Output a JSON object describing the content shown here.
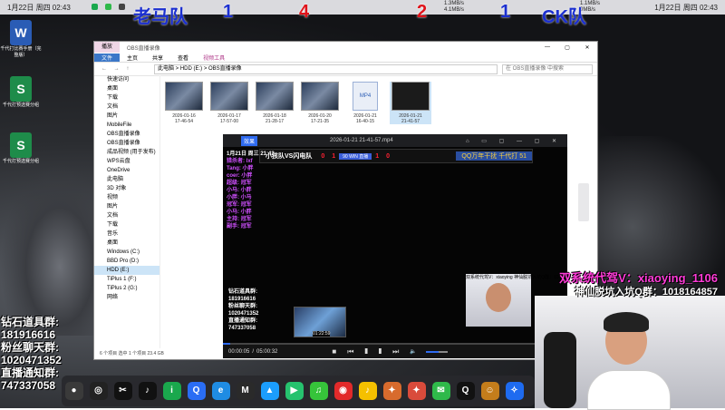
{
  "status_bar": {
    "left_time": "1月22日 周四 02:43",
    "right_time": "1月22日 周四 02:43",
    "net_speed_1": "1.3MB/s",
    "net_speed_2": "4.1MB/s",
    "net_speed_3": "1.1MB/s",
    "net_speed_4": "0MB/s"
  },
  "score_overlay": {
    "team_left": "老马队",
    "team_right": "CK队",
    "scores": [
      "1",
      "4",
      "2",
      "1"
    ]
  },
  "desktop_icons": [
    {
      "label": "千代打比赛手册（完整版）",
      "color": "#2a5cb5",
      "glyph": "W"
    },
    {
      "label": "千代打预选赛分组",
      "color": "#1e8c4a",
      "glyph": "S"
    },
    {
      "label": "千代打预选赛分组",
      "color": "#1e8c4a",
      "glyph": "S"
    }
  ],
  "explorer": {
    "tab_label": "播放",
    "window_title": "OBS直播录像",
    "ribbon": [
      "文件",
      "主页",
      "共享",
      "查看",
      "视频工具"
    ],
    "path": "此电脑 > HDD (E:) > OBS直播录像",
    "search_placeholder": "在 OBS直播录像 中搜索",
    "sidebar": [
      "快速访问",
      "桌面",
      "下载",
      "文档",
      "图片",
      "MobileFile",
      "OBS直播录像",
      "OBS直播录像",
      "成品视频 (用于发布)",
      "WPS云盘",
      "OneDrive",
      "此电脑",
      "3D 对象",
      "视频",
      "图片",
      "文档",
      "下载",
      "音乐",
      "桌面",
      "Windows (C:)",
      "BBD Pro (D:)",
      "HDD (E:)",
      "TiPlus 1 (F:)",
      "TiPlus 2 (G:)",
      "网络"
    ],
    "files": [
      {
        "date": "2026-01-16",
        "time": "17-46-54"
      },
      {
        "date": "2026-01-17",
        "time": "17-57-00"
      },
      {
        "date": "2026-01-18",
        "time": "21-28-17"
      },
      {
        "date": "2026-01-20",
        "time": "17-21-35"
      },
      {
        "date": "2026-01-21",
        "time": "16-40-15"
      },
      {
        "date": "2026-01-21",
        "time": "21-41-57"
      }
    ],
    "mp4_label": "MP4",
    "footer": "6 个项目    选中 1 个项目  23.4 GB"
  },
  "player": {
    "logo": "效果",
    "title": "2026-01-21 21-41-57.mp4",
    "window_buttons": "⌂ ▭ ▢ — ▢ ✕",
    "time_current": "00:00:05",
    "time_total": "05:00:32",
    "speed_label": "倍速",
    "progress": 0.02,
    "volume": 0.6,
    "scorebar": {
      "left_team": "小孩队VS闪电队",
      "left_score": "0",
      "left_score2": "1",
      "mid": "90 WIN  直播",
      "right_score": "1",
      "right_score2": "0",
      "right_label": "QQ万年干扰 千代打 51"
    },
    "left_text": [
      "1月21日 周三 21:42",
      "猎杀者: lxf",
      "Tang: 小胖",
      "coer: 小胖",
      "",
      "超级: 冠军",
      "小马: 小胖",
      "小胖: 小马",
      "",
      "冠军: 冠军",
      "小马: 小胖",
      "主持: 冠军",
      "副手: 冠军"
    ],
    "bottom_text": [
      "钻石道具群:",
      "181916616",
      "粉丝聊天群:",
      "1020471352",
      "直播通知群:",
      "747337058"
    ],
    "thumb_time": "01:22:59"
  },
  "right_overlay": {
    "ad_line_1": "双系统代驾V：xiaoying_1106",
    "ad_line_2": "神仙脱坑入坑Q群：1018164857",
    "small_text": "双系统代驾V：xiaoying 神仙脱坑入坑Q群：1018"
  },
  "left_overlay": [
    "钻石道具群:",
    "181916616",
    "粉丝聊天群:",
    "1020471352",
    "直播通知群:",
    "747337058"
  ],
  "taskbar_apps": [
    {
      "name": "obs-studio",
      "color": "#3a3a3a",
      "glyph": "●"
    },
    {
      "name": "obs-icon-2",
      "color": "#222",
      "glyph": "◎"
    },
    {
      "name": "capcut",
      "color": "#111",
      "glyph": "✂"
    },
    {
      "name": "tiktok",
      "color": "#111",
      "glyph": "♪"
    },
    {
      "name": "iqiyi",
      "color": "#1aa84d",
      "glyph": "i"
    },
    {
      "name": "search-app",
      "color": "#2a6df4",
      "glyph": "Q"
    },
    {
      "name": "edge",
      "color": "#1f8ce3",
      "glyph": "e"
    },
    {
      "name": "mango",
      "color": "#2a2a2a",
      "glyph": "M"
    },
    {
      "name": "tencent-video",
      "color": "#1b9dfc",
      "glyph": "▲"
    },
    {
      "name": "video-player",
      "color": "#26c26e",
      "glyph": "▶"
    },
    {
      "name": "music",
      "color": "#36c43a",
      "glyph": "♫"
    },
    {
      "name": "netease-music",
      "color": "#e22a2a",
      "glyph": "◉"
    },
    {
      "name": "qq-music",
      "color": "#f5c000",
      "glyph": "♪"
    },
    {
      "name": "game-1",
      "color": "#d86b2d",
      "glyph": "✦"
    },
    {
      "name": "game-2",
      "color": "#d94b3b",
      "glyph": "✦"
    },
    {
      "name": "wechat",
      "color": "#2fb94a",
      "glyph": "✉"
    },
    {
      "name": "qq",
      "color": "#111",
      "glyph": "Q"
    },
    {
      "name": "game-3",
      "color": "#c47d1b",
      "glyph": "☺"
    },
    {
      "name": "feishu",
      "color": "#1e6bf0",
      "glyph": "✧"
    }
  ]
}
